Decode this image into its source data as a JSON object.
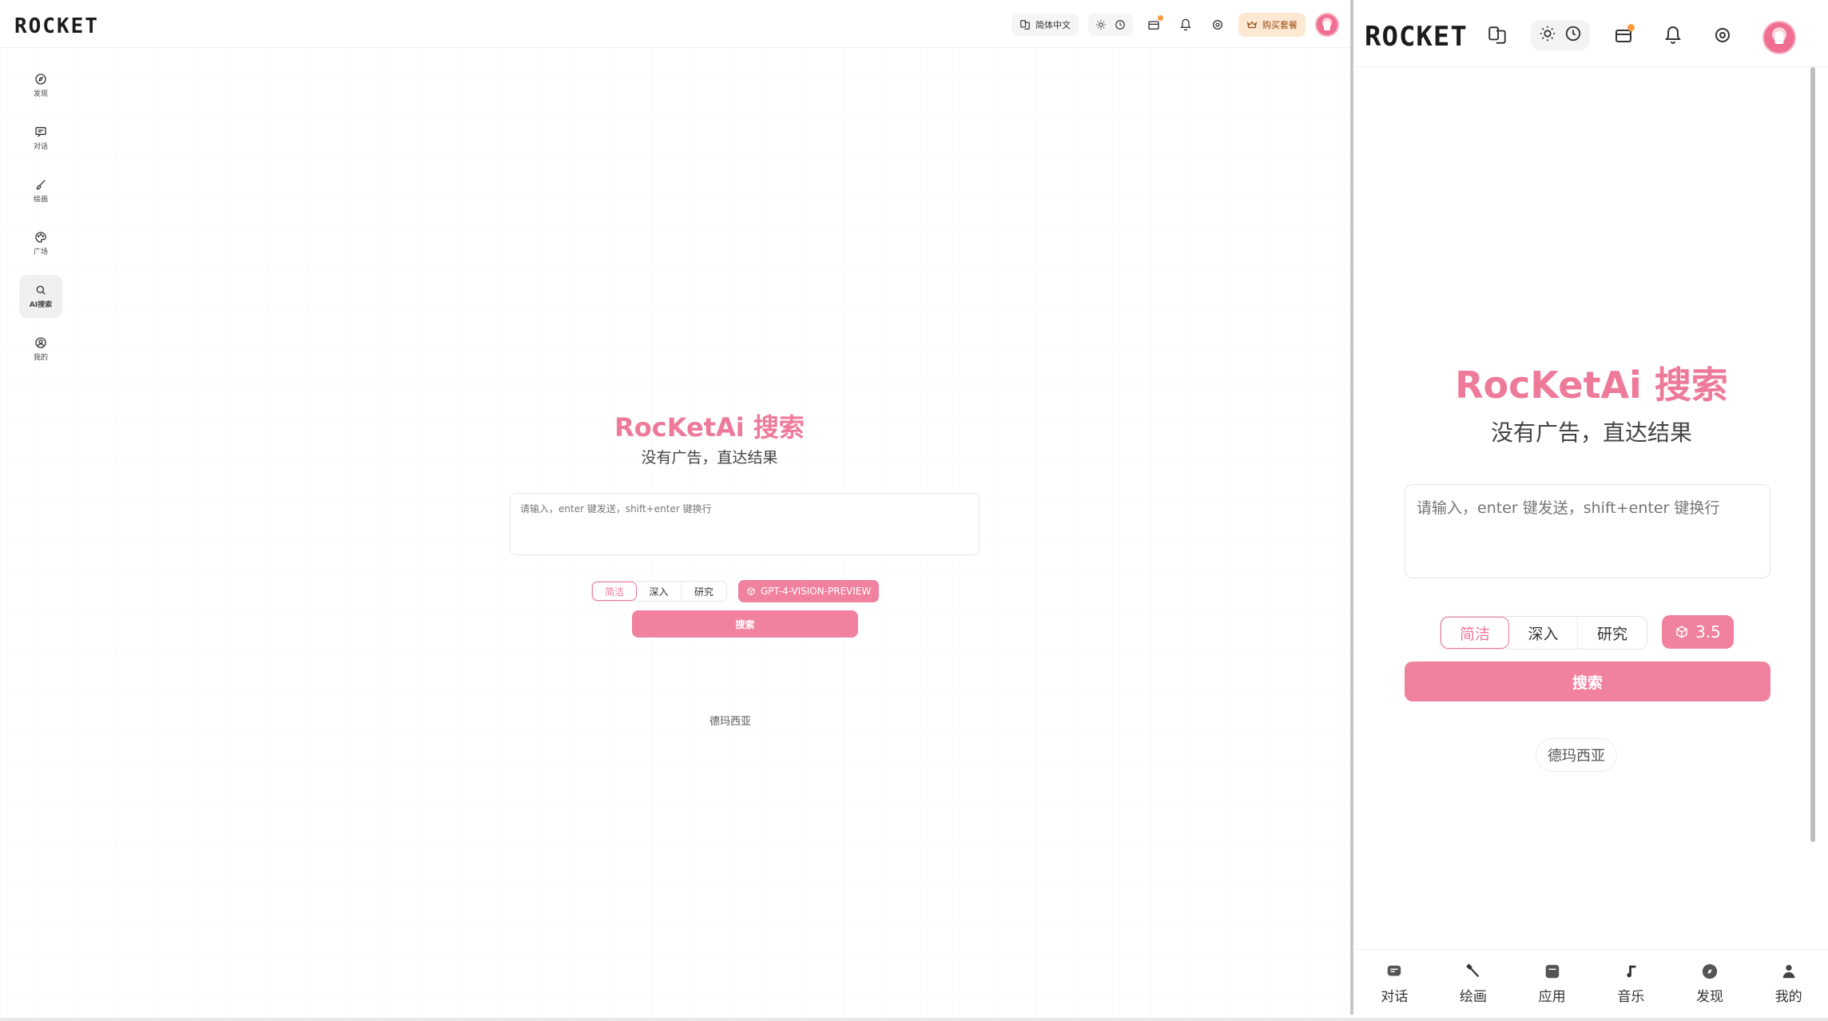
{
  "desktop": {
    "logo": "ROCKET",
    "header": {
      "language": "简体中文",
      "buy_label": "购买套餐"
    },
    "sidebar": {
      "items": [
        {
          "label": "发现",
          "icon": "compass-icon"
        },
        {
          "label": "对话",
          "icon": "chat-icon"
        },
        {
          "label": "绘画",
          "icon": "brush-icon"
        },
        {
          "label": "广场",
          "icon": "palette-icon"
        },
        {
          "label": "AI搜索",
          "icon": "search-icon",
          "active": true
        },
        {
          "label": "我的",
          "icon": "user-circle-icon"
        }
      ]
    },
    "main": {
      "title": "RocKetAi 搜索",
      "subtitle": "没有广告，直达结果",
      "input_placeholder": "请输入，enter 键发送，shift+enter 键换行",
      "modes": [
        "简洁",
        "深入",
        "研究"
      ],
      "selected_mode": "简洁",
      "model": "GPT-4-VISION-PREVIEW",
      "search_label": "搜索",
      "suggestion": "德玛西亚"
    }
  },
  "mobile": {
    "logo": "ROCKET",
    "main": {
      "title": "RocKetAi 搜索",
      "subtitle": "没有广告，直达结果",
      "input_placeholder": "请输入，enter 键发送，shift+enter 键换行",
      "modes": [
        "简洁",
        "深入",
        "研究"
      ],
      "selected_mode": "简洁",
      "model": "3.5",
      "search_label": "搜索",
      "suggestion": "德玛西亚"
    },
    "tabbar": [
      {
        "label": "对话",
        "icon": "chat-bubble-icon"
      },
      {
        "label": "绘画",
        "icon": "brush-icon"
      },
      {
        "label": "应用",
        "icon": "app-icon"
      },
      {
        "label": "音乐",
        "icon": "music-note-icon"
      },
      {
        "label": "发现",
        "icon": "compass-icon"
      },
      {
        "label": "我的",
        "icon": "user-icon"
      }
    ]
  },
  "colors": {
    "accent": "#f0829f",
    "accent_text": "#ee7a9a",
    "notification_dot": "#ff9a3c",
    "buy_chip_bg": "#fde8d4"
  }
}
